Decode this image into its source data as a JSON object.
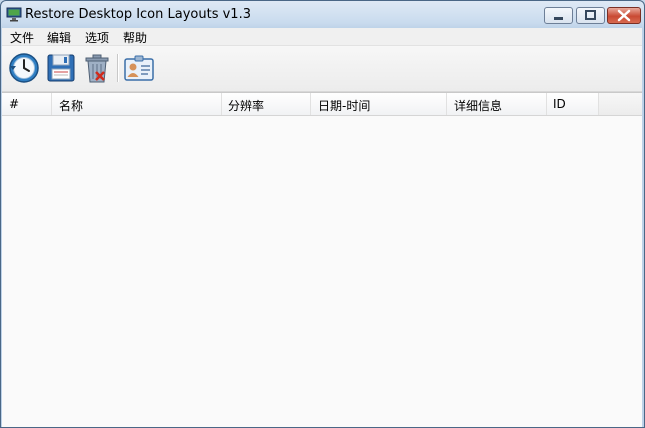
{
  "window": {
    "title": "Restore Desktop Icon Layouts v1.3"
  },
  "menu": [
    "文件",
    "编辑",
    "选项",
    "帮助"
  ],
  "toolbar": [
    {
      "name": "restore-layout-button",
      "icon": "clock-arrow-icon"
    },
    {
      "name": "save-layout-button",
      "icon": "floppy-disk-icon"
    },
    {
      "name": "delete-layout-button",
      "icon": "trash-can-icon"
    },
    {
      "name": "properties-button",
      "icon": "id-card-icon"
    }
  ],
  "columns": [
    "#",
    "名称",
    "分辨率",
    "日期-时间",
    "详细信息",
    "ID"
  ],
  "colors": {
    "title_bar": "#c9dbee",
    "close_button": "#c94a34",
    "list_bg": "#fafafa"
  }
}
